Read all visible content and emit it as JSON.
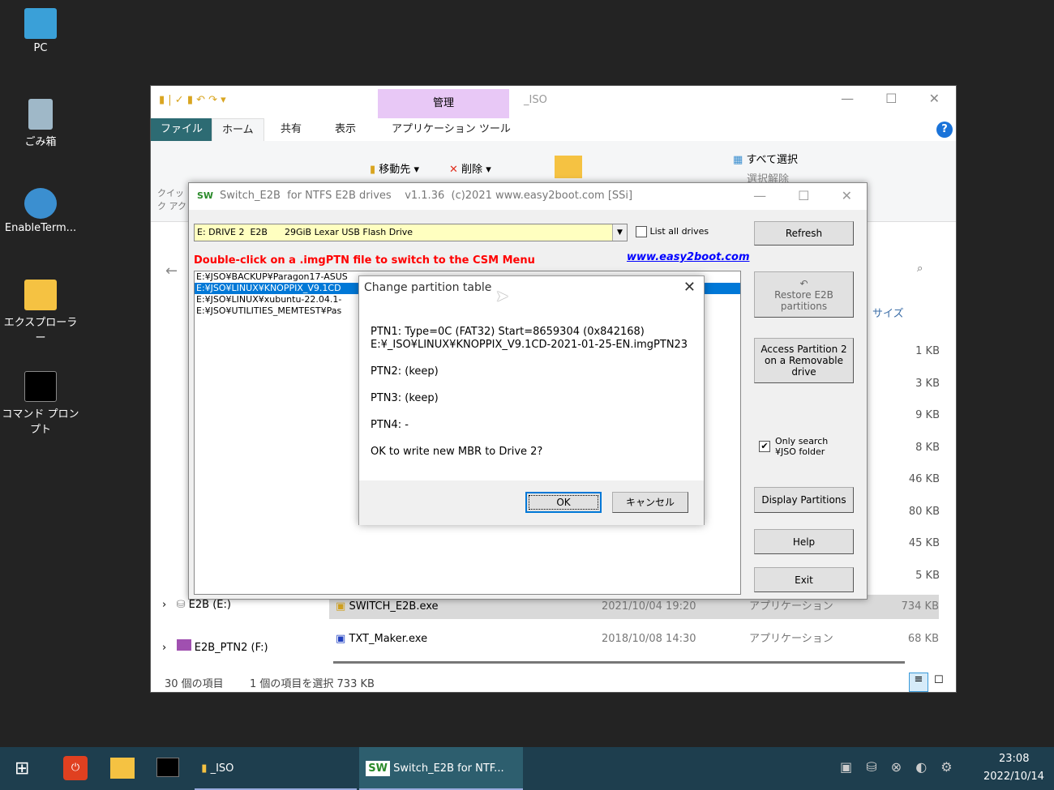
{
  "desktop": {
    "icons": [
      {
        "label": "PC"
      },
      {
        "label": "ごみ箱"
      },
      {
        "label": "EnableTerm..."
      },
      {
        "label": "エクスプローラー"
      },
      {
        "label": "コマンド プロンプト"
      }
    ]
  },
  "explorer": {
    "title": "_ISO",
    "context_tab": "管理",
    "tabs": [
      "ファイル",
      "ホーム",
      "共有",
      "表示",
      "アプリケーション ツール"
    ],
    "ribbon": {
      "pin": "クイック アクセスにピン",
      "move_to": "移動先",
      "delete": "削除",
      "select_all": "すべて選択",
      "deselect": "選択解除"
    },
    "size_header": "サイズ",
    "sizes": [
      "1 KB",
      "3 KB",
      "9 KB",
      "8 KB",
      "46 KB",
      "80 KB",
      "45 KB",
      "5 KB"
    ],
    "nav": [
      {
        "label": "E2B (E:)"
      },
      {
        "label": "E2B_PTN2 (F:)"
      }
    ],
    "files": [
      {
        "name": "SWITCH_E2B.exe",
        "date": "2021/10/04 19:20",
        "type": "アプリケーション",
        "size": "734 KB"
      },
      {
        "name": "TXT_Maker.exe",
        "date": "2018/10/08 14:30",
        "type": "アプリケーション",
        "size": "68 KB"
      }
    ],
    "status": {
      "count": "30 個の項目",
      "selected": "1 個の項目を選択  733 KB"
    }
  },
  "switch": {
    "title": "Switch_E2B  for NTFS E2B drives    v1.1.36  (c)2021 www.easy2boot.com [SSi]",
    "logo": "SW",
    "drive": "E: DRIVE 2  E2B      29GiB Lexar USB Flash Drive",
    "list_all": "List all drives",
    "instruction": "Double-click on a .imgPTN file to switch to the CSM Menu",
    "link": "www.easy2boot.com",
    "files": [
      "E:¥JSO¥BACKUP¥Paragon17-ASUS",
      "E:¥JSO¥LINUX¥KNOPPIX_V9.1CD",
      "E:¥JSO¥LINUX¥xubuntu-22.04.1-",
      "E:¥JSO¥UTILITIES_MEMTEST¥Pas"
    ],
    "buttons": {
      "refresh": "Refresh",
      "restore": "Restore E2B partitions",
      "access": "Access Partition 2 on a Removable drive",
      "display": "Display Partitions",
      "help": "Help",
      "exit": "Exit"
    },
    "only_search": "Only search ¥JSO folder",
    "only_search_checked": true
  },
  "dialog": {
    "title": "Change partition table",
    "ptn1": "PTN1: Type=0C (FAT32)  Start=8659304 (0x842168)",
    "ptn1_file": "E:¥_ISO¥LINUX¥KNOPPIX_V9.1CD-2021-01-25-EN.imgPTN23",
    "ptn2": "PTN2: (keep)",
    "ptn3": "PTN3: (keep)",
    "ptn4": "PTN4: -",
    "question": "OK to write new MBR to Drive 2?",
    "ok": "OK",
    "cancel": "キャンセル"
  },
  "taskbar": {
    "items": [
      {
        "label": "_ISO"
      },
      {
        "label": "Switch_E2B  for NTF..."
      }
    ],
    "time": "23:08",
    "date": "2022/10/14"
  }
}
